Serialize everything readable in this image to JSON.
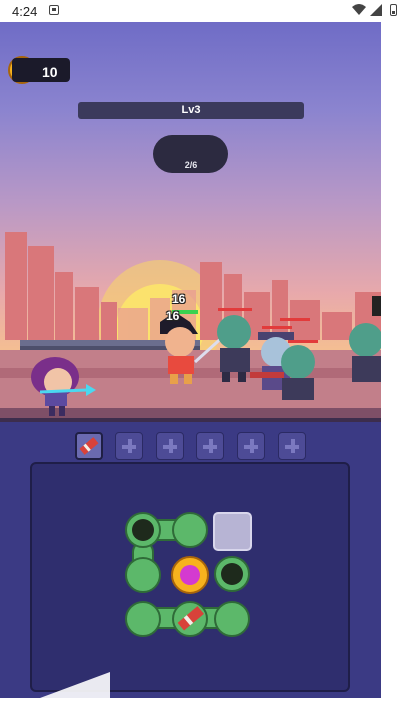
{
  "status_bar": {
    "time": "4:24",
    "icons": [
      "notification-icon",
      "wifi-icon",
      "signal-icon",
      "battery-icon"
    ]
  },
  "hud": {
    "coins": "10",
    "level": "Lv3",
    "wave": "2/6"
  },
  "battle": {
    "hero_hp_top": "16",
    "hero_hp_bottom": "16"
  },
  "inventory": {
    "slots": [
      "filled",
      "empty",
      "empty",
      "empty",
      "empty",
      "empty"
    ]
  },
  "colors": {
    "panel": "#3b3a84",
    "board": "#2f2e6e",
    "gear_green": "#5cb86a",
    "zombie_skin": "#4f9e8a"
  }
}
